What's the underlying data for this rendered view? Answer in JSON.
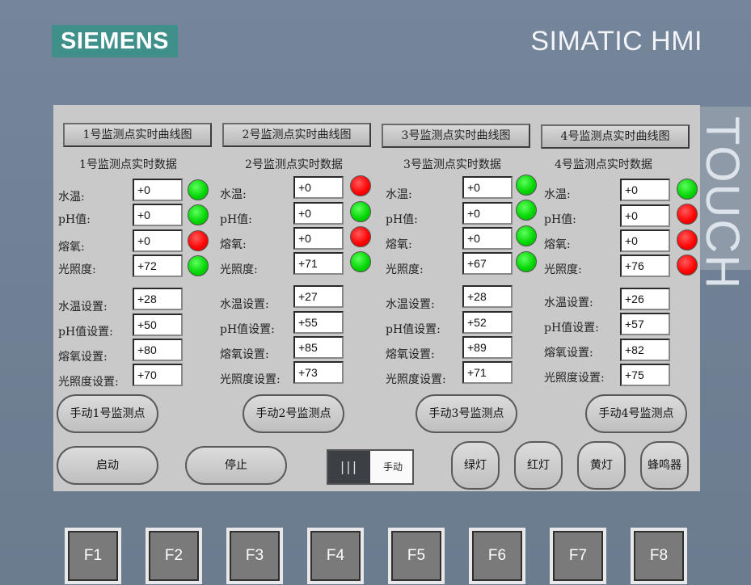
{
  "header": {
    "logo": "SIEMENS",
    "brand": "SIMATIC HMI",
    "side_label": "TOUCH"
  },
  "curve_buttons": [
    "1号监测点实时曲线图",
    "2号监测点实时曲线图",
    "3号监测点实时曲线图",
    "4号监测点实时曲线图"
  ],
  "points": [
    {
      "title": "1号监测点实时数据",
      "readings": [
        {
          "label": "水温:",
          "value": "+0",
          "status": "green"
        },
        {
          "label": "pH值:",
          "value": "+0",
          "status": "green"
        },
        {
          "label": "熔氧:",
          "value": "+0",
          "status": "red"
        },
        {
          "label": "光照度:",
          "value": "+72",
          "status": "green"
        }
      ],
      "settings": [
        {
          "label": "水温设置:",
          "value": "+28"
        },
        {
          "label": "pH值设置:",
          "value": "+50"
        },
        {
          "label": "熔氧设置:",
          "value": "+80"
        },
        {
          "label": "光照度设置:",
          "value": "+70"
        }
      ],
      "manual_button": "手动1号监测点"
    },
    {
      "title": "2号监测点实时数据",
      "readings": [
        {
          "label": "水温:",
          "value": "+0",
          "status": "red"
        },
        {
          "label": "光照度:",
          "value": "+71",
          "status": "green"
        },
        {
          "label": "pH值:",
          "value": "+0",
          "status": "green"
        },
        {
          "label": "熔氧:",
          "value": "+0",
          "status": "red"
        }
      ],
      "settings": [
        {
          "label": "水温设置:",
          "value": "+27"
        },
        {
          "label": "pH值设置:",
          "value": "+55"
        },
        {
          "label": "熔氧设置:",
          "value": "+85"
        },
        {
          "label": "光照度设置:",
          "value": "+73"
        }
      ],
      "manual_button": "手动2号监测点"
    },
    {
      "title": "3号监测点实时数据",
      "readings": [
        {
          "label": "水温:",
          "value": "+0",
          "status": "green"
        },
        {
          "label": "pH值:",
          "value": "+0",
          "status": "green"
        },
        {
          "label": "熔氧:",
          "value": "+0",
          "status": "green"
        },
        {
          "label": "光照度:",
          "value": "+67",
          "status": "green"
        }
      ],
      "settings": [
        {
          "label": "水温设置:",
          "value": "+28"
        },
        {
          "label": "pH值设置:",
          "value": "+52"
        },
        {
          "label": "熔氧设置:",
          "value": "+89"
        },
        {
          "label": "光照度设置:",
          "value": "+71"
        }
      ],
      "manual_button": "手动3号监测点"
    },
    {
      "title": "4号监测点实时数据",
      "readings": [
        {
          "label": "水温:",
          "value": "+0",
          "status": "green"
        },
        {
          "label": "pH值:",
          "value": "+0",
          "status": "red"
        },
        {
          "label": "熔氧:",
          "value": "+0",
          "status": "red"
        },
        {
          "label": "光照度:",
          "value": "+76",
          "status": "red"
        }
      ],
      "settings": [
        {
          "label": "水温设置:",
          "value": "+26"
        },
        {
          "label": "pH值设置:",
          "value": "+57"
        },
        {
          "label": "熔氧设置:",
          "value": "+82"
        },
        {
          "label": "光照度设置:",
          "value": "+75"
        }
      ],
      "manual_button": "手动4号监测点"
    }
  ],
  "controls": {
    "start": "启动",
    "stop": "停止",
    "mode_label": "手动",
    "mode_knob": "|||",
    "green_light": "绿灯",
    "red_light": "红灯",
    "yellow_light": "黄灯",
    "buzzer": "蜂鸣器"
  },
  "function_keys": [
    "F1",
    "F2",
    "F3",
    "F4",
    "F5",
    "F6",
    "F7",
    "F8"
  ],
  "colors": {
    "screen_bg": "#c9c9c9",
    "lamp_green": "#00d400",
    "lamp_red": "#ff0000",
    "logo_bg": "#3f8f8a"
  }
}
